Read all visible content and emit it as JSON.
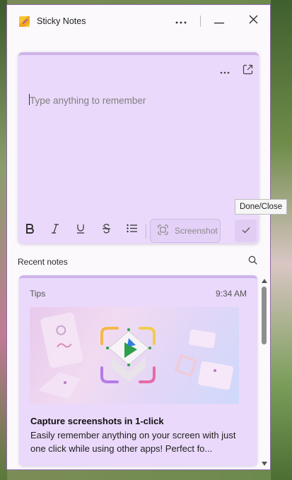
{
  "window": {
    "title": "Sticky Notes",
    "accent": "#ead9fb",
    "border": "#8f6aa8"
  },
  "titlebar": {
    "icons": [
      "sticky-notes-app-icon",
      "more-options-icon",
      "minimize-icon",
      "close-icon"
    ]
  },
  "editor": {
    "placeholder": "Type anything to remember",
    "value": "",
    "toolbar": {
      "icons": [
        "bold-icon",
        "italic-icon",
        "underline-icon",
        "strikethrough-icon",
        "bullet-list-icon"
      ],
      "screenshot_label": "Screenshot",
      "done_icon": "checkmark-icon"
    },
    "tooltip": "Done/Close"
  },
  "recent": {
    "title": "Recent notes",
    "notes": [
      {
        "tag": "Tips",
        "time": "9:34 AM",
        "heading": "Capture screenshots in 1-click",
        "body": "Easily remember anything on your screen with just one click while using other apps! Perfect fo..."
      }
    ]
  }
}
